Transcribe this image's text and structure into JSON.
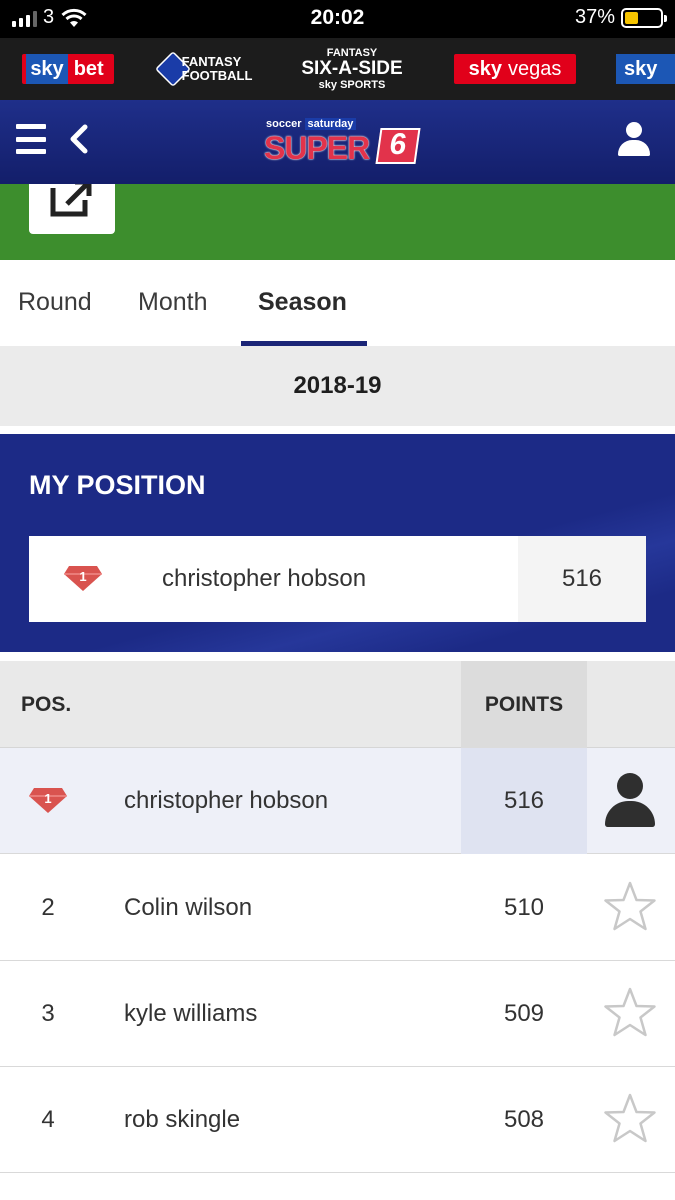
{
  "status_bar": {
    "carrier": "3",
    "time": "20:02",
    "battery_percent": "37%",
    "battery_level": 0.37,
    "battery_color": "#f5c400"
  },
  "brands": {
    "sky_bet": {
      "sky": "sky",
      "bet": "bet"
    },
    "fantasy_football": {
      "line1": "FANTASY",
      "line2": "FOOTBALL"
    },
    "six_a_side": {
      "top": "FANTASY",
      "main": "SIX-A-SIDE",
      "sub": "sky SPORTS"
    },
    "sky_vegas": {
      "sky": "sky",
      "vegas": "vegas"
    },
    "sky_cut": "sky"
  },
  "header": {
    "logo_top_left": "soccer",
    "logo_top_right": "saturday",
    "logo_main": "SUPER",
    "logo_number": "6",
    "accent_color": "#1b2577",
    "logo_red": "#e2334b"
  },
  "banner": {
    "color": "#3d8e2d",
    "edit_icon": "share-edit-icon"
  },
  "tabs": [
    {
      "label": "Round",
      "active": false
    },
    {
      "label": "Month",
      "active": false
    },
    {
      "label": "Season",
      "active": true
    }
  ],
  "season_label": "2018-19",
  "my_position": {
    "title": "MY POSITION",
    "rank": "1",
    "name": "christopher hobson",
    "points": "516"
  },
  "table": {
    "headers": {
      "pos": "POS.",
      "points": "POINTS"
    },
    "rows": [
      {
        "pos": "1",
        "name": "christopher hobson",
        "points": "516",
        "is_me": true,
        "icon": "user-icon"
      },
      {
        "pos": "2",
        "name": "Colin wilson",
        "points": "510",
        "is_me": false,
        "icon": "star-outline-icon"
      },
      {
        "pos": "3",
        "name": "kyle williams",
        "points": "509",
        "is_me": false,
        "icon": "star-outline-icon"
      },
      {
        "pos": "4",
        "name": "rob skingle",
        "points": "508",
        "is_me": false,
        "icon": "star-outline-icon"
      }
    ]
  },
  "gem_color": "#d9534f"
}
